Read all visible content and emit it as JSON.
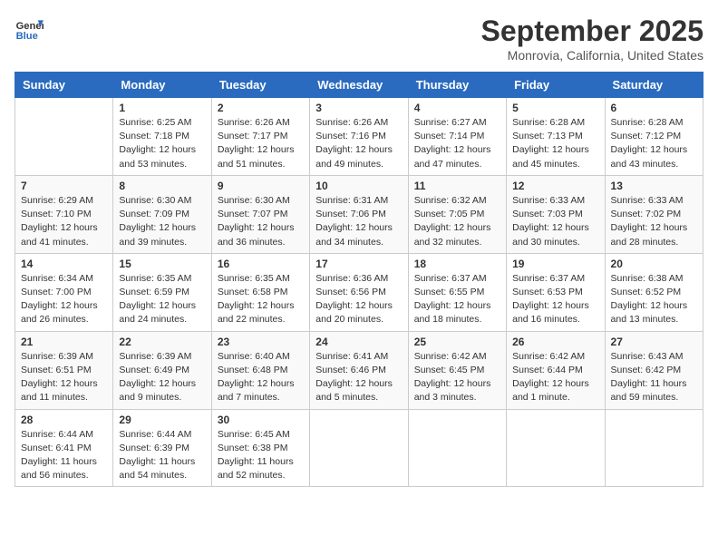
{
  "header": {
    "logo_line1": "General",
    "logo_line2": "Blue",
    "month": "September 2025",
    "location": "Monrovia, California, United States"
  },
  "weekdays": [
    "Sunday",
    "Monday",
    "Tuesday",
    "Wednesday",
    "Thursday",
    "Friday",
    "Saturday"
  ],
  "weeks": [
    [
      {
        "day": "",
        "info": ""
      },
      {
        "day": "1",
        "info": "Sunrise: 6:25 AM\nSunset: 7:18 PM\nDaylight: 12 hours\nand 53 minutes."
      },
      {
        "day": "2",
        "info": "Sunrise: 6:26 AM\nSunset: 7:17 PM\nDaylight: 12 hours\nand 51 minutes."
      },
      {
        "day": "3",
        "info": "Sunrise: 6:26 AM\nSunset: 7:16 PM\nDaylight: 12 hours\nand 49 minutes."
      },
      {
        "day": "4",
        "info": "Sunrise: 6:27 AM\nSunset: 7:14 PM\nDaylight: 12 hours\nand 47 minutes."
      },
      {
        "day": "5",
        "info": "Sunrise: 6:28 AM\nSunset: 7:13 PM\nDaylight: 12 hours\nand 45 minutes."
      },
      {
        "day": "6",
        "info": "Sunrise: 6:28 AM\nSunset: 7:12 PM\nDaylight: 12 hours\nand 43 minutes."
      }
    ],
    [
      {
        "day": "7",
        "info": "Sunrise: 6:29 AM\nSunset: 7:10 PM\nDaylight: 12 hours\nand 41 minutes."
      },
      {
        "day": "8",
        "info": "Sunrise: 6:30 AM\nSunset: 7:09 PM\nDaylight: 12 hours\nand 39 minutes."
      },
      {
        "day": "9",
        "info": "Sunrise: 6:30 AM\nSunset: 7:07 PM\nDaylight: 12 hours\nand 36 minutes."
      },
      {
        "day": "10",
        "info": "Sunrise: 6:31 AM\nSunset: 7:06 PM\nDaylight: 12 hours\nand 34 minutes."
      },
      {
        "day": "11",
        "info": "Sunrise: 6:32 AM\nSunset: 7:05 PM\nDaylight: 12 hours\nand 32 minutes."
      },
      {
        "day": "12",
        "info": "Sunrise: 6:33 AM\nSunset: 7:03 PM\nDaylight: 12 hours\nand 30 minutes."
      },
      {
        "day": "13",
        "info": "Sunrise: 6:33 AM\nSunset: 7:02 PM\nDaylight: 12 hours\nand 28 minutes."
      }
    ],
    [
      {
        "day": "14",
        "info": "Sunrise: 6:34 AM\nSunset: 7:00 PM\nDaylight: 12 hours\nand 26 minutes."
      },
      {
        "day": "15",
        "info": "Sunrise: 6:35 AM\nSunset: 6:59 PM\nDaylight: 12 hours\nand 24 minutes."
      },
      {
        "day": "16",
        "info": "Sunrise: 6:35 AM\nSunset: 6:58 PM\nDaylight: 12 hours\nand 22 minutes."
      },
      {
        "day": "17",
        "info": "Sunrise: 6:36 AM\nSunset: 6:56 PM\nDaylight: 12 hours\nand 20 minutes."
      },
      {
        "day": "18",
        "info": "Sunrise: 6:37 AM\nSunset: 6:55 PM\nDaylight: 12 hours\nand 18 minutes."
      },
      {
        "day": "19",
        "info": "Sunrise: 6:37 AM\nSunset: 6:53 PM\nDaylight: 12 hours\nand 16 minutes."
      },
      {
        "day": "20",
        "info": "Sunrise: 6:38 AM\nSunset: 6:52 PM\nDaylight: 12 hours\nand 13 minutes."
      }
    ],
    [
      {
        "day": "21",
        "info": "Sunrise: 6:39 AM\nSunset: 6:51 PM\nDaylight: 12 hours\nand 11 minutes."
      },
      {
        "day": "22",
        "info": "Sunrise: 6:39 AM\nSunset: 6:49 PM\nDaylight: 12 hours\nand 9 minutes."
      },
      {
        "day": "23",
        "info": "Sunrise: 6:40 AM\nSunset: 6:48 PM\nDaylight: 12 hours\nand 7 minutes."
      },
      {
        "day": "24",
        "info": "Sunrise: 6:41 AM\nSunset: 6:46 PM\nDaylight: 12 hours\nand 5 minutes."
      },
      {
        "day": "25",
        "info": "Sunrise: 6:42 AM\nSunset: 6:45 PM\nDaylight: 12 hours\nand 3 minutes."
      },
      {
        "day": "26",
        "info": "Sunrise: 6:42 AM\nSunset: 6:44 PM\nDaylight: 12 hours\nand 1 minute."
      },
      {
        "day": "27",
        "info": "Sunrise: 6:43 AM\nSunset: 6:42 PM\nDaylight: 11 hours\nand 59 minutes."
      }
    ],
    [
      {
        "day": "28",
        "info": "Sunrise: 6:44 AM\nSunset: 6:41 PM\nDaylight: 11 hours\nand 56 minutes."
      },
      {
        "day": "29",
        "info": "Sunrise: 6:44 AM\nSunset: 6:39 PM\nDaylight: 11 hours\nand 54 minutes."
      },
      {
        "day": "30",
        "info": "Sunrise: 6:45 AM\nSunset: 6:38 PM\nDaylight: 11 hours\nand 52 minutes."
      },
      {
        "day": "",
        "info": ""
      },
      {
        "day": "",
        "info": ""
      },
      {
        "day": "",
        "info": ""
      },
      {
        "day": "",
        "info": ""
      }
    ]
  ]
}
